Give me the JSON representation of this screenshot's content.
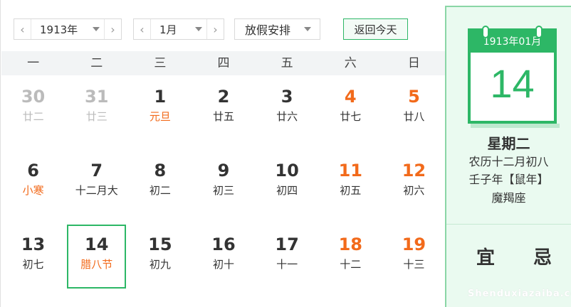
{
  "toolbar": {
    "year_value": "1913年",
    "month_value": "1月",
    "holiday_label": "放假安排",
    "today_label": "返回今天",
    "prev_arrow": "‹",
    "next_arrow": "›"
  },
  "weekdays": [
    "一",
    "二",
    "三",
    "四",
    "五",
    "六",
    "日"
  ],
  "days": [
    {
      "num": "30",
      "sub": "廿二",
      "other": true
    },
    {
      "num": "31",
      "sub": "廿三",
      "other": true
    },
    {
      "num": "1",
      "sub": "元旦",
      "festival": true
    },
    {
      "num": "2",
      "sub": "廿五"
    },
    {
      "num": "3",
      "sub": "廿六"
    },
    {
      "num": "4",
      "sub": "廿七",
      "weekend": true
    },
    {
      "num": "5",
      "sub": "廿八",
      "weekend": true
    },
    {
      "num": "6",
      "sub": "小寒",
      "festival": true
    },
    {
      "num": "7",
      "sub": "十二月大"
    },
    {
      "num": "8",
      "sub": "初二"
    },
    {
      "num": "9",
      "sub": "初三"
    },
    {
      "num": "10",
      "sub": "初四"
    },
    {
      "num": "11",
      "sub": "初五",
      "weekend": true
    },
    {
      "num": "12",
      "sub": "初六",
      "weekend": true
    },
    {
      "num": "13",
      "sub": "初七"
    },
    {
      "num": "14",
      "sub": "腊八节",
      "festival": true,
      "selected": true
    },
    {
      "num": "15",
      "sub": "初九"
    },
    {
      "num": "16",
      "sub": "初十"
    },
    {
      "num": "17",
      "sub": "十一"
    },
    {
      "num": "18",
      "sub": "十二",
      "weekend": true
    },
    {
      "num": "19",
      "sub": "十三",
      "weekend": true
    }
  ],
  "side": {
    "card_header": "1913年01月",
    "big_day": "14",
    "weekday": "星期二",
    "lunar": "农历十二月初八",
    "ganzhi": "壬子年【鼠年】",
    "zodiac": "魔羯座",
    "yi": "宜",
    "ji": "忌",
    "watermark": "Shenduxiazaiba.com"
  },
  "colors": {
    "accent": "#2db766",
    "weekend": "#f26a1b",
    "muted": "#bbbbbb"
  }
}
